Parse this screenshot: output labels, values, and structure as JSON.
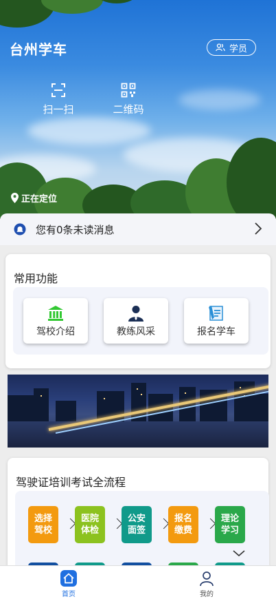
{
  "header": {
    "app_title": "台州学车",
    "role_button_label": "学员",
    "quick_actions": [
      {
        "label": "扫一扫",
        "icon": "scan-icon"
      },
      {
        "label": "二维码",
        "icon": "qr-code-icon"
      }
    ],
    "location_text": "正在定位"
  },
  "notice": {
    "text": "您有0条未读消息",
    "icon": "bell-icon"
  },
  "common_functions": {
    "title": "常用功能",
    "items": [
      {
        "label": "驾校介绍",
        "icon": "school-building-icon",
        "color": "#32c832"
      },
      {
        "label": "教练风采",
        "icon": "coach-person-icon",
        "color": "#1b2f55"
      },
      {
        "label": "报名学车",
        "icon": "signup-form-icon",
        "color": "#2a8fd6"
      }
    ]
  },
  "process": {
    "title": "驾驶证培训考试全流程",
    "steps": [
      {
        "label": "选择驾校",
        "color": "#f39a0f"
      },
      {
        "label": "医院体检",
        "color": "#8cc21f"
      },
      {
        "label": "公安面签",
        "color": "#109a8a"
      },
      {
        "label": "报名缴费",
        "color": "#f39a0f"
      },
      {
        "label": "理论学习",
        "color": "#2aa84a"
      }
    ],
    "next_row_colors": [
      "#124fa0",
      "#109a8a",
      "#124fa0",
      "#2aa84a",
      "#109a8a"
    ]
  },
  "tabbar": {
    "items": [
      {
        "label": "首页",
        "icon": "home-icon",
        "active": true
      },
      {
        "label": "我的",
        "icon": "user-icon",
        "active": false
      }
    ],
    "active_color": "#1f6fe0"
  }
}
